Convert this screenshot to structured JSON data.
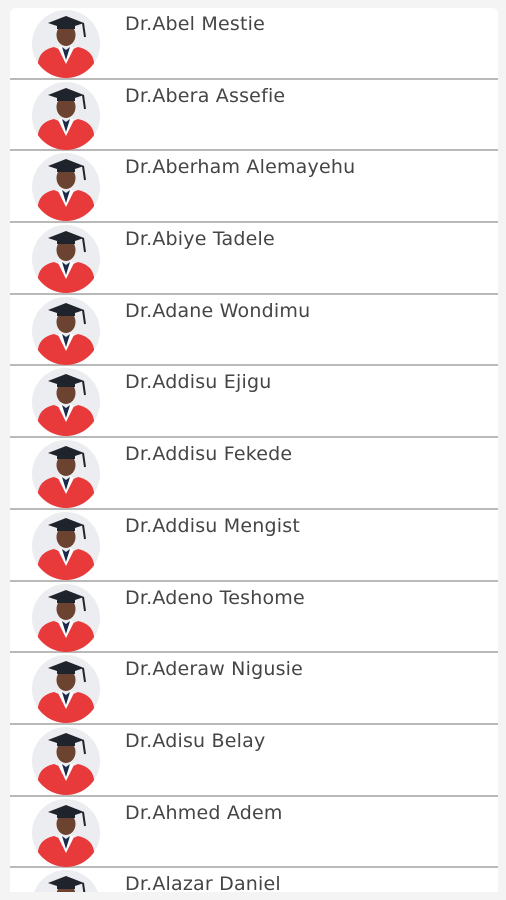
{
  "list": {
    "items": [
      {
        "name": "Dr.Abel Mestie",
        "avatar": "graduate-photo"
      },
      {
        "name": "Dr.Abera Assefie",
        "avatar": "graduate-photo"
      },
      {
        "name": "Dr.Aberham Alemayehu",
        "avatar": "graduate-photo"
      },
      {
        "name": "Dr.Abiye Tadele",
        "avatar": "graduate-photo"
      },
      {
        "name": "Dr.Adane Wondimu",
        "avatar": "graduate-photo"
      },
      {
        "name": "Dr.Addisu Ejigu",
        "avatar": "graduate-photo"
      },
      {
        "name": "Dr.Addisu Fekede",
        "avatar": "graduate-photo"
      },
      {
        "name": "Dr.Addisu Mengist",
        "avatar": "graduate-photo"
      },
      {
        "name": "Dr.Adeno Teshome",
        "avatar": "graduate-photo"
      },
      {
        "name": "Dr.Aderaw Nigusie",
        "avatar": "graduate-photo"
      },
      {
        "name": "Dr.Adisu Belay",
        "avatar": "graduate-photo"
      },
      {
        "name": "Dr.Ahmed Adem",
        "avatar": "graduate-photo"
      },
      {
        "name": "Dr.Alazar Daniel",
        "avatar": "graduate-photo"
      }
    ]
  },
  "colors": {
    "gown_red": "#e83a3a",
    "cap": "#1f232b",
    "skin": "#6b4330",
    "divider": "#b9b9b9",
    "text": "#454545"
  }
}
